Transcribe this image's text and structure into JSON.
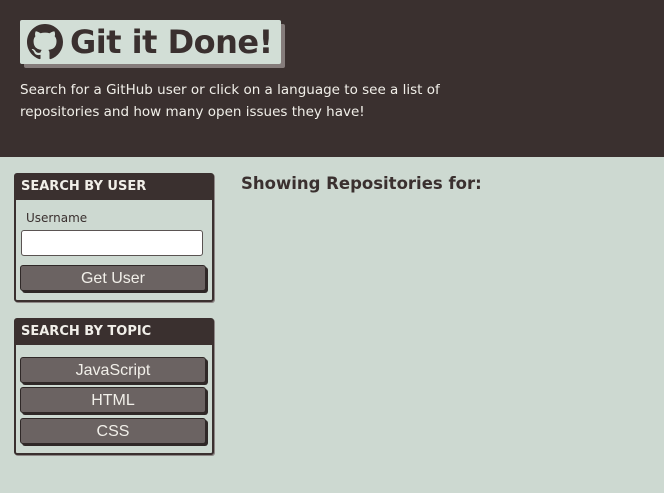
{
  "header": {
    "title": "Git it Done!",
    "logo_icon": "github-icon",
    "intro": "Search for a GitHub user or click on a language to see a list of repositories and how many open issues they have!"
  },
  "search_user": {
    "heading": "SEARCH BY USER",
    "username_label": "Username",
    "username_value": "",
    "button_label": "Get User"
  },
  "search_topic": {
    "heading": "SEARCH BY TOPIC",
    "languages": [
      "JavaScript",
      "HTML",
      "CSS"
    ]
  },
  "main": {
    "heading": "Showing Repositories for:"
  },
  "colors": {
    "header_bg": "#3a302f",
    "page_bg": "#cdd9d1",
    "button_bg": "#6b6362"
  }
}
